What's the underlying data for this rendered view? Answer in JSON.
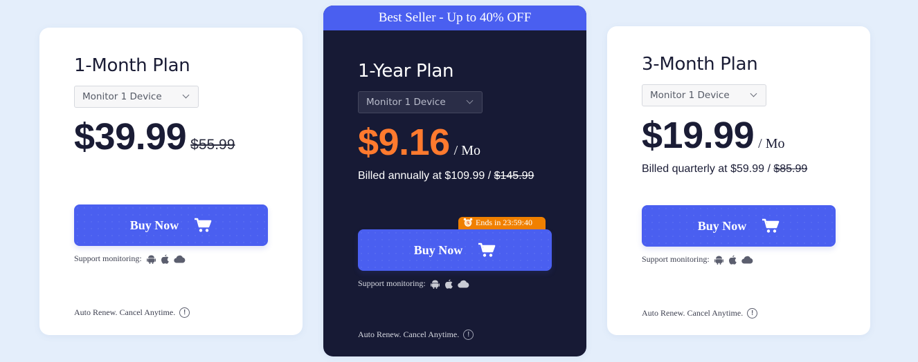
{
  "plans": [
    {
      "title": "1-Month Plan",
      "device_select": "Monitor 1 Device",
      "price": "$39.99",
      "old_price": "$55.99",
      "buy_label": "Buy Now",
      "support_label": "Support monitoring:",
      "support_icons": [
        "android-icon",
        "apple-icon",
        "cloud-icon"
      ],
      "renew_label": "Auto Renew. Cancel Anytime."
    },
    {
      "banner": "Best Seller - Up to 40% OFF",
      "title": "1-Year Plan",
      "device_select": "Monitor 1 Device",
      "price": "$9.16",
      "per": "/ Mo",
      "billed_prefix": "Billed annually at $109.99 /",
      "billed_old": "$145.99",
      "timer": "Ends in 23:59:40",
      "buy_label": "Buy Now",
      "support_label": "Support monitoring:",
      "support_icons": [
        "android-icon",
        "apple-icon",
        "cloud-icon"
      ],
      "renew_label": "Auto Renew. Cancel Anytime."
    },
    {
      "title": "3-Month Plan",
      "device_select": "Monitor 1 Device",
      "price": "$19.99",
      "per": "/ Mo",
      "billed_prefix": "Billed quarterly at $59.99 /",
      "billed_old": "$85.99",
      "buy_label": "Buy Now",
      "support_label": "Support monitoring:",
      "support_icons": [
        "android-icon",
        "apple-icon",
        "cloud-icon"
      ],
      "renew_label": "Auto Renew. Cancel Anytime."
    }
  ],
  "colors": {
    "background": "#e4eefb",
    "accent": "#4a5ff0",
    "featured_card": "#171a35",
    "featured_price": "#ff7a2e",
    "timer_badge": "#f08000"
  }
}
